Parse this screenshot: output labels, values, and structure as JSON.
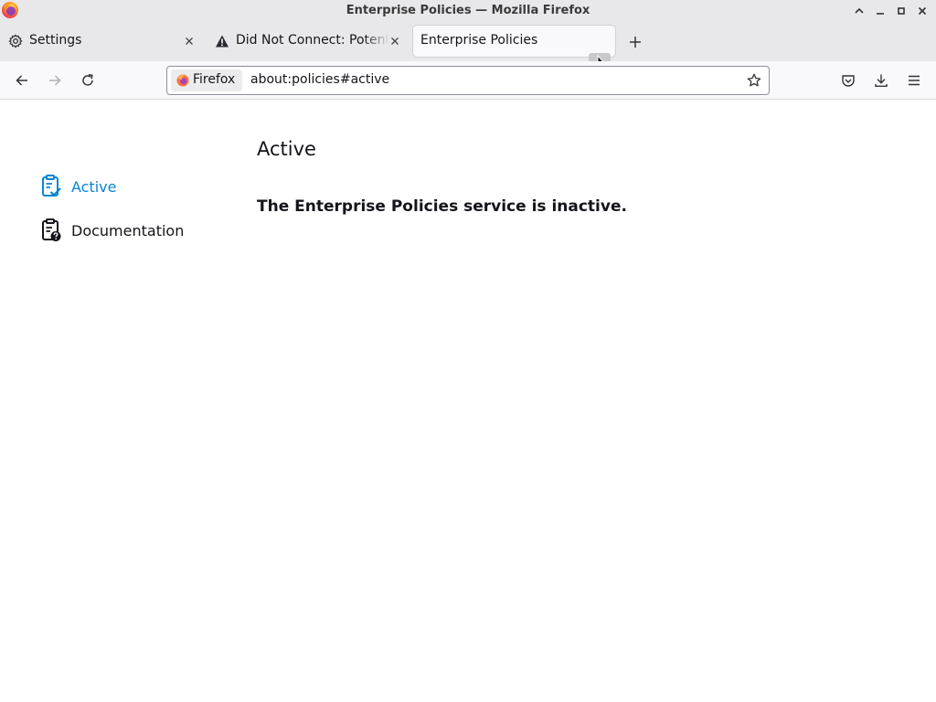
{
  "window": {
    "title": "Enterprise Policies — Mozilla Firefox"
  },
  "tabs": [
    {
      "label": "Settings",
      "icon": "gear-icon"
    },
    {
      "label": "Did Not Connect: Potenti",
      "icon": "warning-icon"
    },
    {
      "label": "Enterprise Policies",
      "icon": "",
      "selected": true
    }
  ],
  "urlbar": {
    "identity_label": "Firefox",
    "url": "about:policies#active"
  },
  "sidebar": {
    "items": [
      {
        "label": "Active",
        "icon": "clipboard-check-icon",
        "active": true
      },
      {
        "label": "Documentation",
        "icon": "clipboard-help-icon",
        "active": false
      }
    ]
  },
  "main": {
    "heading": "Active",
    "message": "The Enterprise Policies service is inactive."
  },
  "colors": {
    "accent": "#0a84d6",
    "chrome": "#e8e8ea",
    "toolbar": "#f9f9fb",
    "text": "#15141a"
  }
}
